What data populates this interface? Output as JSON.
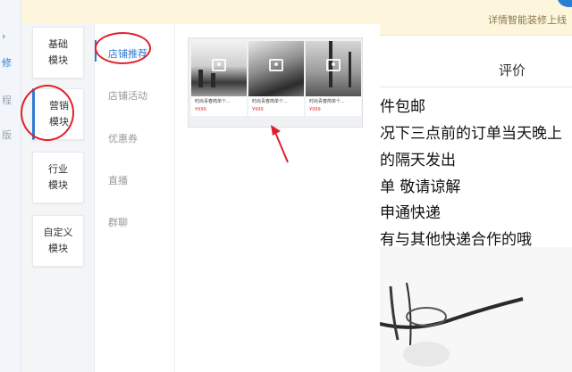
{
  "left_edge": {
    "text_1": "修",
    "text_2": "程",
    "text_3": "版"
  },
  "topbar": {
    "notice": "详情智能装修上线"
  },
  "modules": [
    {
      "label_line1": "基础",
      "label_line2": "模块"
    },
    {
      "label_line1": "营销",
      "label_line2": "模块"
    },
    {
      "label_line1": "行业",
      "label_line2": "模块"
    },
    {
      "label_line1": "自定义",
      "label_line2": "模块"
    }
  ],
  "categories": [
    "店铺推荐",
    "店铺活动",
    "优惠券",
    "直播",
    "群聊"
  ],
  "recommend_card": {
    "items": [
      {
        "name": "时尚青春简单个...",
        "price": "¥999"
      },
      {
        "name": "时尚青春简单个...",
        "price": "¥999"
      },
      {
        "name": "时尚青春简单个...",
        "price": "¥999"
      }
    ]
  },
  "right_content": {
    "column_title": "评价",
    "lines": [
      "件包邮",
      "况下三点前的订单当天晚上",
      "的隔天发出",
      "单 敬请谅解",
      "申通快递",
      "有与其他快递合作的哦"
    ]
  },
  "colors": {
    "accent": "#2e7bd1",
    "annotation": "#e0202a",
    "notice_bg": "#fdf6dc"
  }
}
